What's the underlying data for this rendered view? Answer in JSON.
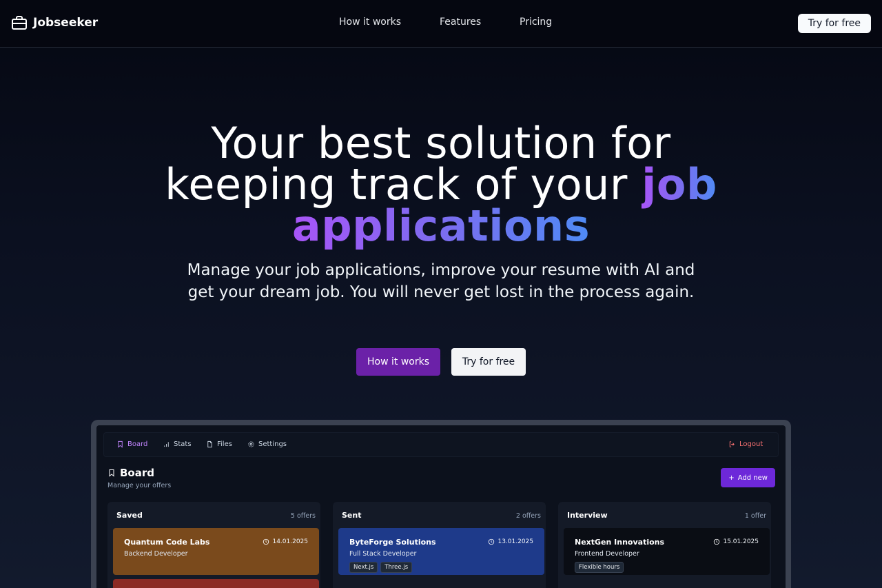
{
  "nav": {
    "brand": "Jobseeker",
    "links": [
      "How it works",
      "Features",
      "Pricing"
    ],
    "cta": "Try for free"
  },
  "hero": {
    "title_line1": "Your best solution for",
    "title_line2_plain": "keeping track of your ",
    "title_line2_accent": "job",
    "title_line3_accent": "applications",
    "subtitle": "Manage your job applications, improve your resume with AI and get your dream job. You will never get lost in the process again.",
    "primary_button": "How it works",
    "secondary_button": "Try for free"
  },
  "app": {
    "nav_items": [
      "Board",
      "Stats",
      "Files",
      "Settings"
    ],
    "logout": "Logout",
    "board_title": "Board",
    "board_subtitle": "Manage your offers",
    "add_new": "Add new",
    "columns": [
      {
        "title": "Saved",
        "count": "5 offers",
        "card": {
          "company": "Quantum Code Labs",
          "role": "Backend Developer",
          "date": "14.01.2025",
          "color": "#7a4a1c",
          "tags": []
        }
      },
      {
        "title": "Sent",
        "count": "2 offers",
        "card": {
          "company": "ByteForge Solutions",
          "role": "Full Stack Developer",
          "date": "13.01.2025",
          "color": "#1e3a8a",
          "tags": [
            "Next.js",
            "Three.js"
          ]
        }
      },
      {
        "title": "Interview",
        "count": "1 offer",
        "card": {
          "company": "NextGen Innovations",
          "role": "Frontend Developer",
          "date": "15.01.2025",
          "color": "#0a0d14",
          "tags": [
            "Flexible hours"
          ]
        }
      }
    ]
  },
  "colors": {
    "accent_purple": "#a855f7",
    "accent_blue": "#4f8bf5",
    "primary_button": "#6b21a8"
  }
}
